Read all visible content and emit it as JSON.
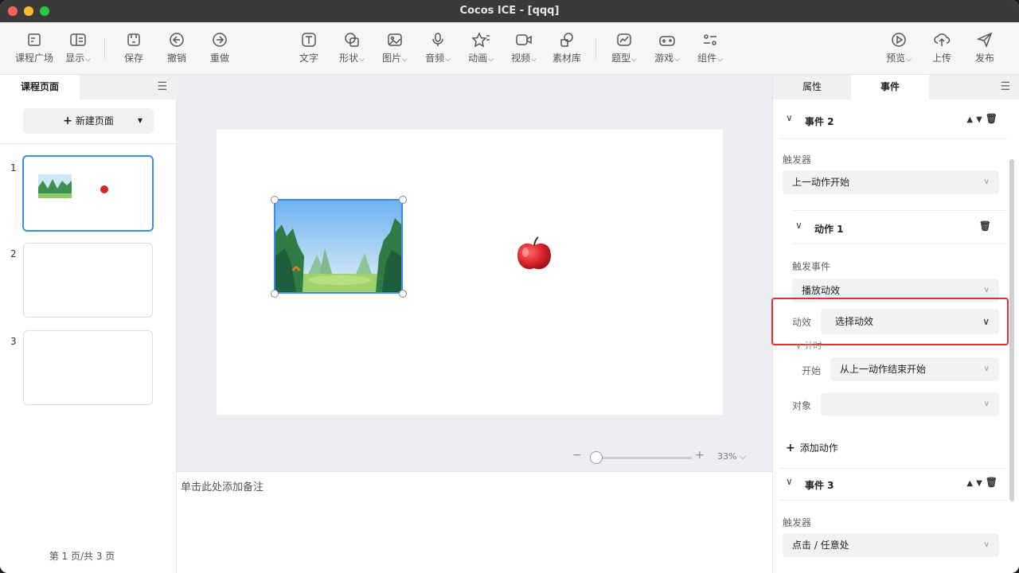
{
  "window": {
    "title": "Cocos ICE - [qqq]"
  },
  "toolbar": {
    "items": [
      {
        "label": "课程广场",
        "icon": "course-square-icon"
      },
      {
        "label": "显示",
        "icon": "display-icon",
        "dropdown": true
      },
      {
        "label": "保存",
        "icon": "save-icon"
      },
      {
        "label": "撤销",
        "icon": "undo-icon"
      },
      {
        "label": "重做",
        "icon": "redo-icon"
      },
      {
        "label": "文字",
        "icon": "text-icon"
      },
      {
        "label": "形状",
        "icon": "shape-icon",
        "dropdown": true
      },
      {
        "label": "图片",
        "icon": "image-icon",
        "dropdown": true
      },
      {
        "label": "音频",
        "icon": "microphone-icon",
        "dropdown": true
      },
      {
        "label": "动画",
        "icon": "animation-icon",
        "dropdown": true
      },
      {
        "label": "视频",
        "icon": "video-icon",
        "dropdown": true
      },
      {
        "label": "素材库",
        "icon": "asset-library-icon"
      },
      {
        "label": "题型",
        "icon": "question-type-icon",
        "dropdown": true
      },
      {
        "label": "游戏",
        "icon": "gamepad-icon",
        "dropdown": true
      },
      {
        "label": "组件",
        "icon": "component-icon",
        "dropdown": true
      },
      {
        "label": "预览",
        "icon": "play-icon",
        "dropdown": true
      },
      {
        "label": "上传",
        "icon": "upload-icon"
      },
      {
        "label": "发布",
        "icon": "send-icon"
      }
    ]
  },
  "left_panel": {
    "tab": "课程页面",
    "new_page": "新建页面",
    "pages": [
      "1",
      "2",
      "3"
    ],
    "pager": "第 1 页/共 3 页"
  },
  "canvas": {
    "zoom": "33%",
    "zoom_level": 0.33
  },
  "notes": {
    "placeholder": "单击此处添加备注"
  },
  "right_panel": {
    "tabs": [
      "属性",
      "事件"
    ],
    "active_tab": "事件",
    "event2": {
      "title": "事件 2",
      "trigger_label": "触发器",
      "trigger_value": "上一动作开始",
      "action": {
        "title": "动作 1",
        "trigger_event_label": "触发事件",
        "trigger_event_value": "播放动效",
        "effect_label": "动效",
        "effect_value": "选择动效",
        "timing_label": "计时",
        "start_label": "开始",
        "start_value": "从上一动作结束开始",
        "target_label": "对象",
        "target_value": ""
      },
      "add_action": "添加动作"
    },
    "event3": {
      "title": "事件 3",
      "trigger_label": "触发器",
      "trigger_value": "点击 / 任意处"
    }
  },
  "colors": {
    "accent": "#3b8de9",
    "highlight": "#e0302a"
  }
}
